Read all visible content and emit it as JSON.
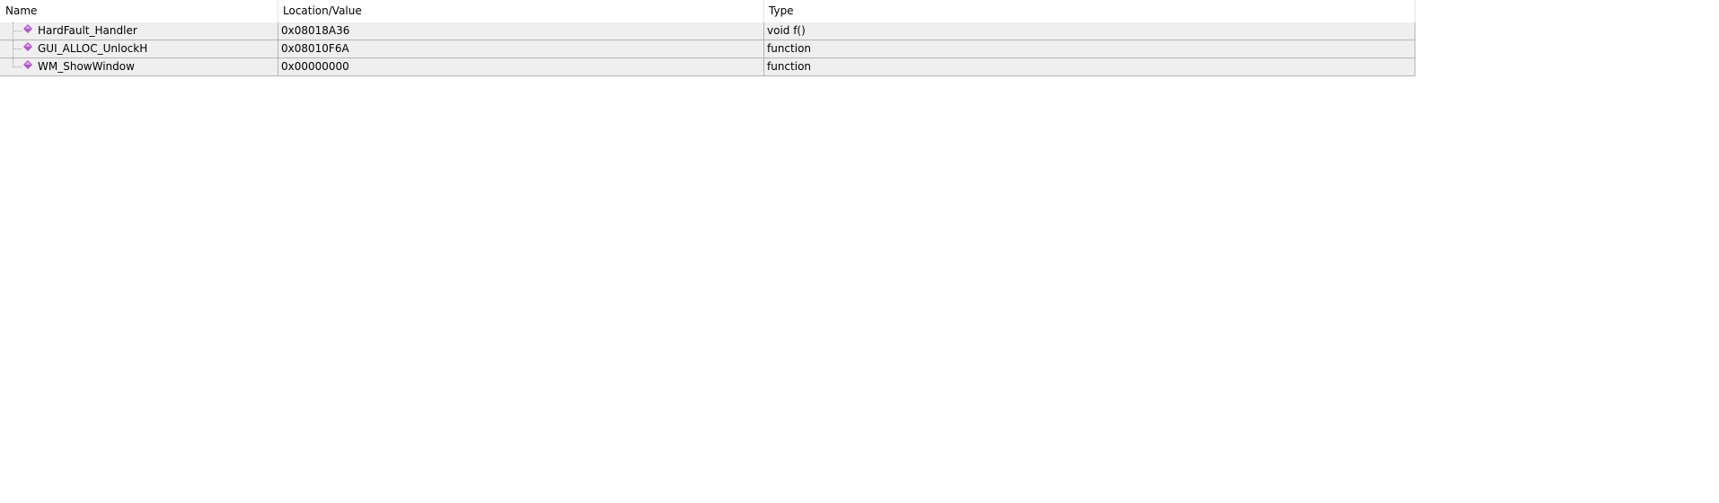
{
  "columns": {
    "name": "Name",
    "location": "Location/Value",
    "type": "Type"
  },
  "rows": [
    {
      "name": "HardFault_Handler",
      "location": "0x08018A36",
      "type": "void f()",
      "icon": "function-diamond-icon"
    },
    {
      "name": "GUI_ALLOC_UnlockH",
      "location": "0x08010F6A",
      "type": "function",
      "icon": "function-diamond-icon"
    },
    {
      "name": "WM_ShowWindow",
      "location": "0x00000000",
      "type": "function",
      "icon": "function-diamond-icon"
    }
  ],
  "colors": {
    "row_bg": "#efefef",
    "grid": "#b4b4b4",
    "icon": "#b84fd0"
  }
}
